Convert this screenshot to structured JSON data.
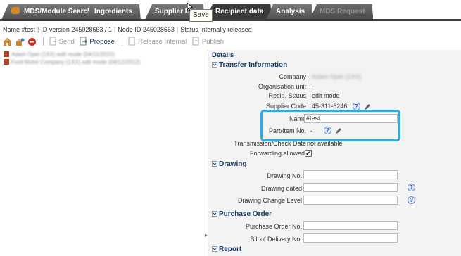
{
  "tabs": [
    {
      "label": "MDS/Module Search",
      "state": "normal"
    },
    {
      "label": "Ingredients",
      "state": "normal"
    },
    {
      "label": "Supplier Dat",
      "state": "normal"
    },
    {
      "label": "Recipient data",
      "state": "active"
    },
    {
      "label": "Analysis",
      "state": "normal"
    },
    {
      "label": "MDS Request",
      "state": "disabled"
    }
  ],
  "tooltip": {
    "text": "Save"
  },
  "infoline": {
    "name": "Name  #test",
    "id_version": "ID version  245028663 / 1",
    "node_id": "Node ID  245028663",
    "status": "Status  Internally released"
  },
  "toolbar": {
    "send": "Send",
    "propose": "Propose",
    "release_internal": "Release Internal",
    "publish": "Publish"
  },
  "left_items": [
    {
      "text": "Adam Opel (1XX) edit mode (04/11/2015)"
    },
    {
      "text": "Ford Motor Company (1XX) edit mode (04/12/2012)"
    }
  ],
  "details": {
    "title": "Details",
    "transfer": {
      "title": "Transfer Information",
      "company_label": "Company",
      "company_value": "Adam Opel (1XX)",
      "org_unit_label": "Organisation unit",
      "org_unit_value": "-",
      "recip_status_label": "Recip. Status",
      "recip_status_value": "edit mode",
      "supplier_code_label": "Supplier Code",
      "supplier_code_value": "45-311-6246",
      "name_label": "Name",
      "name_value": "#test",
      "part_label": "Part/Item No.",
      "part_value": "-",
      "transmission_label": "Transmission/Check Date",
      "transmission_value": "not available",
      "forwarding_label": "Forwarding allowed",
      "forwarding_checked": "✔"
    },
    "drawing": {
      "title": "Drawing",
      "drawing_no_label": "Drawing No.",
      "drawing_dated_label": "Drawing dated",
      "drawing_change_label": "Drawing Change Level"
    },
    "purchase": {
      "title": "Purchase Order",
      "po_label": "Purchase Order No.",
      "bill_label": "Bill of Delivery No."
    },
    "report": {
      "title": "Report"
    }
  },
  "colors": {
    "highlight": "#3aa8dc",
    "section_title": "#17375e",
    "tab_bg": "#4e4e4e"
  }
}
